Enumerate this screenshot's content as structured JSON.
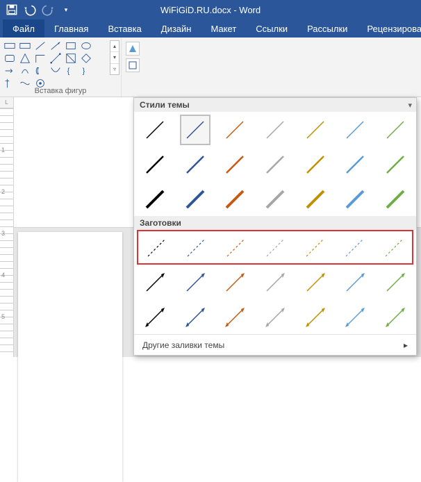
{
  "title": "WiFiGiD.RU.docx - Word",
  "qat": {
    "save": "save",
    "undo": "undo",
    "redo": "redo",
    "customize": "customize"
  },
  "tabs": {
    "file": "Файл",
    "home": "Главная",
    "insert": "Вставка",
    "design": "Дизайн",
    "layout": "Макет",
    "references": "Ссылки",
    "mailings": "Рассылки",
    "review": "Рецензирование"
  },
  "shapes_group_label": "Вставка фигур",
  "gallery": {
    "section_theme": "Стили темы",
    "section_presets": "Заготовки",
    "more": "Другие заливки темы"
  },
  "ruler_marks": [
    "1",
    "2",
    "3",
    "4",
    "5"
  ],
  "theme_colors": [
    "#000000",
    "#2f5597",
    "#c55a11",
    "#a6a6a6",
    "#bf9000",
    "#5b9bd5",
    "#70ad47"
  ],
  "theme_weights": [
    1.5,
    2.5,
    4
  ],
  "preset_rows": [
    "dashed",
    "arrow-end",
    "arrow-both"
  ],
  "selected_swatch": {
    "row": 0,
    "col": 1
  }
}
